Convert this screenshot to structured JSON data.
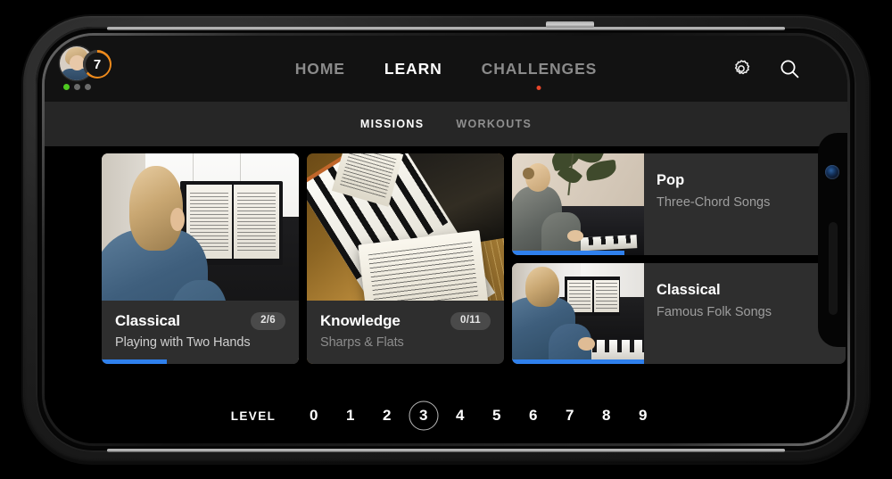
{
  "app": {
    "accent_blue": "#2f80ed",
    "accent_orange": "#ef8b1c",
    "notify_red": "#e8462a",
    "streak_green": "#4ec820"
  },
  "header": {
    "profile": {
      "level_value": "7",
      "streak_dots": [
        true,
        false,
        false
      ]
    },
    "nav": [
      {
        "label": "HOME",
        "active": false,
        "has_dot": false
      },
      {
        "label": "LEARN",
        "active": true,
        "has_dot": false
      },
      {
        "label": "CHALLENGES",
        "active": false,
        "has_dot": true
      }
    ],
    "actions": [
      {
        "name": "gear-icon",
        "label": "Settings"
      },
      {
        "name": "search-icon",
        "label": "Search"
      }
    ]
  },
  "subtabs": [
    {
      "label": "MISSIONS",
      "active": true
    },
    {
      "label": "WORKOUTS",
      "active": false
    }
  ],
  "tiles": [
    {
      "title": "Classical",
      "subtitle": "Playing with Two Hands",
      "badge": "2/6",
      "progress_pct": 33,
      "subtitle_dim": false,
      "scene": "A"
    },
    {
      "title": "Knowledge",
      "subtitle": "Sharps & Flats",
      "badge": "0/11",
      "progress_pct": 0,
      "subtitle_dim": true,
      "scene": "B"
    }
  ],
  "rows": [
    {
      "title": "Pop",
      "subtitle": "Three-Chord Songs",
      "progress_pct": 85,
      "scene": "C"
    },
    {
      "title": "Classical",
      "subtitle": "Famous Folk Songs",
      "progress_pct": 100,
      "scene": "D"
    }
  ],
  "level_selector": {
    "label": "LEVEL",
    "levels": [
      "0",
      "1",
      "2",
      "3",
      "4",
      "5",
      "6",
      "7",
      "8",
      "9"
    ],
    "selected": "3"
  }
}
